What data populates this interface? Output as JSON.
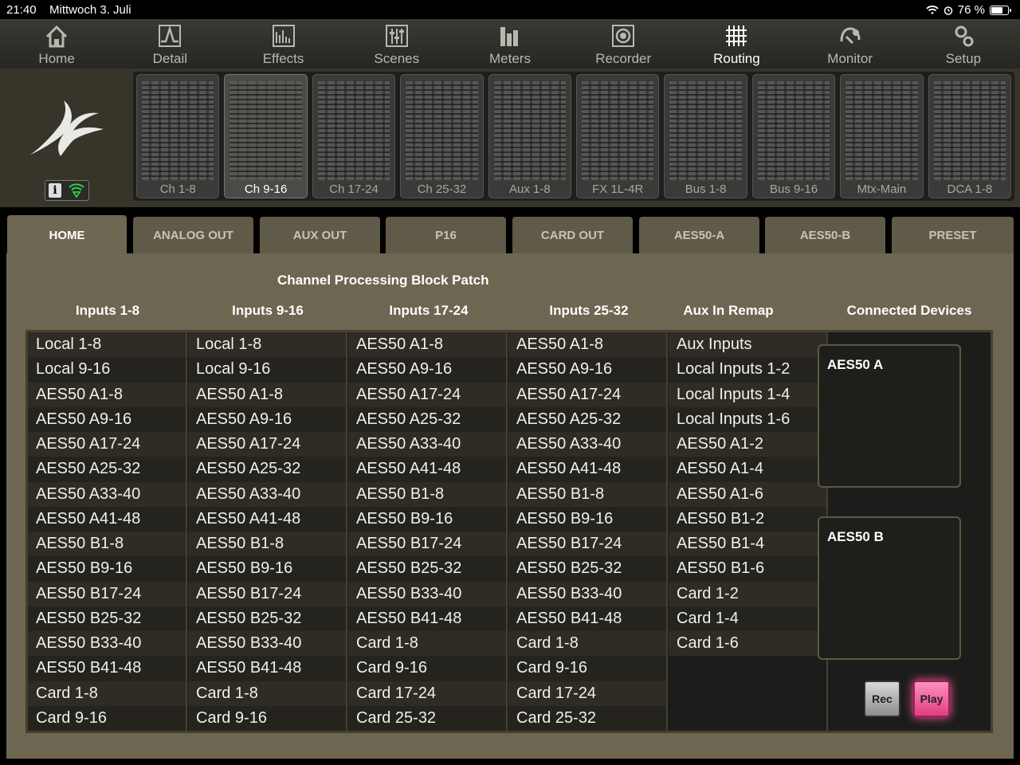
{
  "status_bar": {
    "time": "21:40",
    "date": "Mittwoch 3. Juli",
    "battery": "76 %",
    "battery_level": 0.76
  },
  "nav": [
    {
      "label": "Home",
      "icon": "home-icon"
    },
    {
      "label": "Detail",
      "icon": "detail-icon"
    },
    {
      "label": "Effects",
      "icon": "effects-icon"
    },
    {
      "label": "Scenes",
      "icon": "scenes-icon"
    },
    {
      "label": "Meters",
      "icon": "meters-icon"
    },
    {
      "label": "Recorder",
      "icon": "recorder-icon"
    },
    {
      "label": "Routing",
      "icon": "routing-icon",
      "active": true
    },
    {
      "label": "Monitor",
      "icon": "monitor-icon"
    },
    {
      "label": "Setup",
      "icon": "setup-icon"
    }
  ],
  "banks": [
    "Ch 1-8",
    "Ch 9-16",
    "Ch 17-24",
    "Ch 25-32",
    "Aux 1-8",
    "FX 1L-4R",
    "Bus 1-8",
    "Bus 9-16",
    "Mtx-Main",
    "DCA 1-8"
  ],
  "active_bank": "Ch 9-16",
  "tabs": [
    "HOME",
    "ANALOG OUT",
    "AUX OUT",
    "P16",
    "CARD OUT",
    "AES50-A",
    "AES50-B",
    "PRESET"
  ],
  "active_tab": "HOME",
  "panel": {
    "title": "Channel Processing Block Patch",
    "columns": [
      {
        "header": "Inputs 1-8",
        "options": [
          "Local 1-8",
          "Local 9-16",
          "AES50 A1-8",
          "AES50 A9-16",
          "AES50 A17-24",
          "AES50 A25-32",
          "AES50 A33-40",
          "AES50 A41-48",
          "AES50 B1-8",
          "AES50 B9-16",
          "AES50 B17-24",
          "AES50 B25-32",
          "AES50 B33-40",
          "AES50 B41-48",
          "Card 1-8",
          "Card 9-16"
        ]
      },
      {
        "header": "Inputs 9-16",
        "options": [
          "Local 1-8",
          "Local 9-16",
          "AES50 A1-8",
          "AES50 A9-16",
          "AES50 A17-24",
          "AES50 A25-32",
          "AES50 A33-40",
          "AES50 A41-48",
          "AES50 B1-8",
          "AES50 B9-16",
          "AES50 B17-24",
          "AES50 B25-32",
          "AES50 B33-40",
          "AES50 B41-48",
          "Card 1-8",
          "Card 9-16"
        ]
      },
      {
        "header": "Inputs 17-24",
        "options": [
          "AES50 A1-8",
          "AES50 A9-16",
          "AES50 A17-24",
          "AES50 A25-32",
          "AES50 A33-40",
          "AES50 A41-48",
          "AES50 B1-8",
          "AES50 B9-16",
          "AES50 B17-24",
          "AES50 B25-32",
          "AES50 B33-40",
          "AES50 B41-48",
          "Card 1-8",
          "Card 9-16",
          "Card 17-24",
          "Card 25-32"
        ]
      },
      {
        "header": "Inputs 25-32",
        "options": [
          "AES50 A1-8",
          "AES50 A9-16",
          "AES50 A17-24",
          "AES50 A25-32",
          "AES50 A33-40",
          "AES50 A41-48",
          "AES50 B1-8",
          "AES50 B9-16",
          "AES50 B17-24",
          "AES50 B25-32",
          "AES50 B33-40",
          "AES50 B41-48",
          "Card 1-8",
          "Card 9-16",
          "Card 17-24",
          "Card 25-32"
        ]
      },
      {
        "header": "Aux In Remap",
        "options": [
          "Aux Inputs",
          "Local Inputs 1-2",
          "Local Inputs 1-4",
          "Local Inputs 1-6",
          "AES50 A1-2",
          "AES50 A1-4",
          "AES50 A1-6",
          "AES50 B1-2",
          "AES50 B1-4",
          "AES50 B1-6",
          "Card 1-2",
          "Card 1-4",
          "Card 1-6"
        ]
      }
    ],
    "connected_devices": {
      "header": "Connected Devices",
      "devices": [
        "AES50 A",
        "AES50 B"
      ]
    },
    "buttons": {
      "rec": "Rec",
      "play": "Play"
    }
  },
  "colors": {
    "panel": "#6d6651",
    "list_bg": "#1c1c1a",
    "play_accent": "#e0407e"
  }
}
